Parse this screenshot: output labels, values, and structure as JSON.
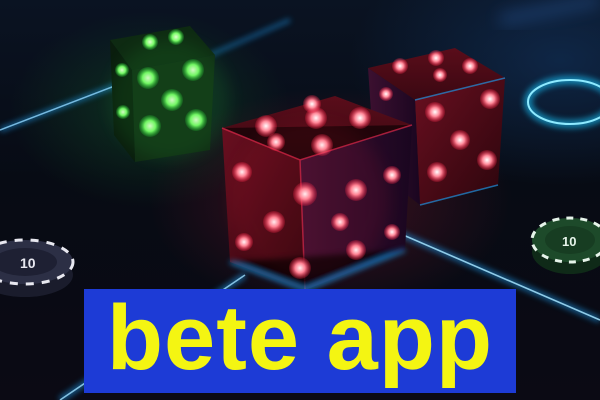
{
  "caption": {
    "text": "bete app",
    "text_color": "#f4f512",
    "box_color": "#1d3bd6"
  },
  "scene": {
    "elements": [
      "green-neon-die",
      "red-neon-die-front",
      "red-neon-die-back",
      "casino-chip-left",
      "casino-chip-right",
      "neon-light-streaks"
    ],
    "chip_labels": [
      "10",
      "10"
    ],
    "colors": {
      "red_die": "#c0102a",
      "pip_glow": "#ff4f6a",
      "green_die": "#2bbf3b",
      "neon_blue": "#1ea7ff"
    }
  }
}
